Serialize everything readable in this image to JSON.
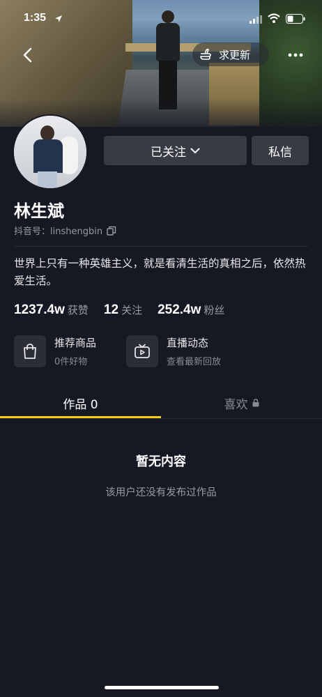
{
  "status_bar": {
    "time": "1:35"
  },
  "header": {
    "update_label": "求更新"
  },
  "profile": {
    "name": "林生斌",
    "douyin_id": "抖音号：linshengbin",
    "bio": "世界上只有一种英雄主义，就是看清生活的真相之后，依然热爱生活。",
    "follow_label": "已关注",
    "message_label": "私信"
  },
  "stats": [
    {
      "value": "1237.4w",
      "label": "获赞"
    },
    {
      "value": "12",
      "label": "关注"
    },
    {
      "value": "252.4w",
      "label": "粉丝"
    }
  ],
  "features": [
    {
      "title": "推荐商品",
      "subtitle": "0件好物",
      "icon": "shopping-bag-icon"
    },
    {
      "title": "直播动态",
      "subtitle": "查看最新回放",
      "icon": "tv-icon"
    }
  ],
  "tabs": [
    {
      "label": "作品 0"
    },
    {
      "label": "喜欢"
    }
  ],
  "empty_state": {
    "title": "暂无内容",
    "subtitle": "该用户还没有发布过作品"
  },
  "colors": {
    "background": "#161823",
    "button": "#393b44",
    "accent": "#face15"
  }
}
